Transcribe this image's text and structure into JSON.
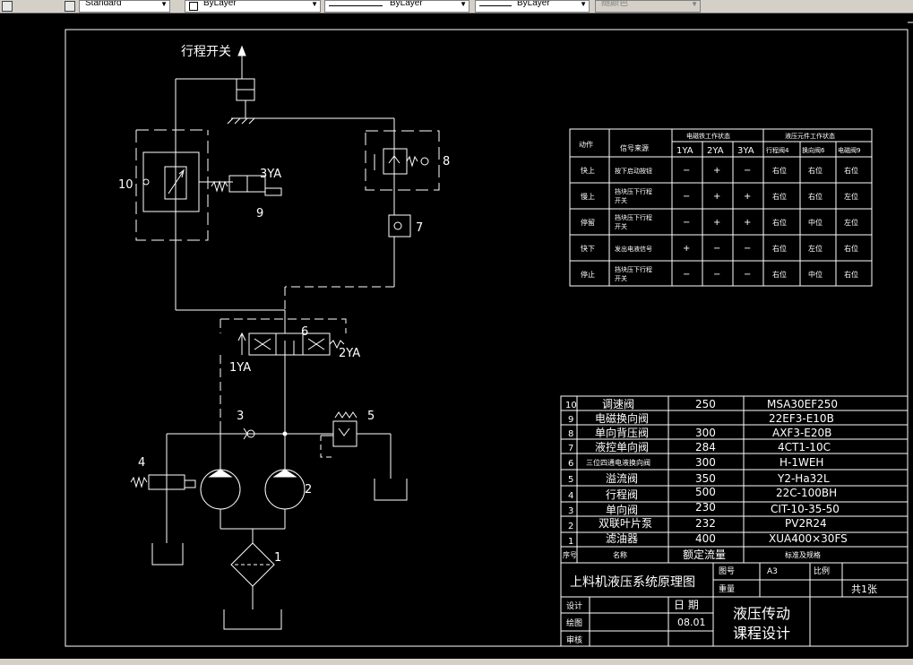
{
  "toolbar": {
    "text_style": "Standard",
    "layer": "ByLayer",
    "linetype": "ByLayer",
    "lineweight": "ByLayer",
    "plotstyle": "随颜色"
  },
  "diagram": {
    "labels": {
      "switch": "行程开关",
      "n10": "10",
      "n3ya": "3YA",
      "n9": "9",
      "n8": "8",
      "n7": "7",
      "n6": "6",
      "n1ya": "1YA",
      "n2ya": "2YA",
      "n3": "3",
      "n5": "5",
      "n4": "4",
      "n2": "2",
      "n1": "1"
    }
  },
  "status_table": {
    "h_action": "动作",
    "h_signal": "信号来源",
    "h_magnet": "电磁铁工作状态",
    "h_hydraulic": "液压元件工作状态",
    "h_1ya": "1YA",
    "h_2ya": "2YA",
    "h_3ya": "3YA",
    "h_v4": "行程阀4",
    "h_v6": "换向阀6",
    "h_v9": "电磁阀9",
    "rows": [
      {
        "action": "快上",
        "sig1": "按下启动按钮",
        "sig2": "",
        "c1": "−",
        "c2": "+",
        "c3": "−",
        "c4": "右位",
        "c5": "右位",
        "c6": "右位"
      },
      {
        "action": "慢上",
        "sig1": "挡块压下行程",
        "sig2": "开关",
        "c1": "−",
        "c2": "+",
        "c3": "+",
        "c4": "右位",
        "c5": "右位",
        "c6": "左位"
      },
      {
        "action": "停留",
        "sig1": "挡块压下行程",
        "sig2": "开关",
        "c1": "−",
        "c2": "+",
        "c3": "+",
        "c4": "右位",
        "c5": "中位",
        "c6": "左位"
      },
      {
        "action": "快下",
        "sig1": "发出电液信号",
        "sig2": "",
        "c1": "+",
        "c2": "−",
        "c3": "−",
        "c4": "右位",
        "c5": "左位",
        "c6": "右位"
      },
      {
        "action": "停止",
        "sig1": "挡块压下行程",
        "sig2": "开关",
        "c1": "−",
        "c2": "−",
        "c3": "−",
        "c4": "右位",
        "c5": "中位",
        "c6": "右位"
      }
    ]
  },
  "parts_list": [
    {
      "no": "10",
      "name": "调速阀",
      "flow": "250",
      "spec": "MSA30EF250"
    },
    {
      "no": "9",
      "name": "电磁换向阀",
      "flow": "",
      "spec": "22EF3-E10B"
    },
    {
      "no": "8",
      "name": "单向背压阀",
      "flow": "300",
      "spec": "AXF3-E20B"
    },
    {
      "no": "7",
      "name": "液控单向阀",
      "flow": "284",
      "spec": "4CT1-10C"
    },
    {
      "no": "6",
      "name": "三位四通电液换向阀",
      "flow": "300",
      "spec": "H-1WEH"
    },
    {
      "no": "5",
      "name": "溢流阀",
      "flow": "350",
      "spec": "Y2-Ha32L"
    },
    {
      "no": "4",
      "name": "行程阀",
      "flow": "500",
      "spec": "22C-100BH"
    },
    {
      "no": "3",
      "name": "单向阀",
      "flow": "230",
      "spec": "CIT-10-35-50"
    },
    {
      "no": "2",
      "name": "双联叶片泵",
      "flow": "232",
      "spec": "PV2R24"
    },
    {
      "no": "1",
      "name": "滤油器",
      "flow": "400",
      "spec": "XUA400×30FS"
    }
  ],
  "parts_header": {
    "no": "序号",
    "name": "名称",
    "flow": "额定流量",
    "spec": "标准及规格"
  },
  "title_block": {
    "drawing_title": "上料机液压系统原理图",
    "drawing_no_label": "图号",
    "drawing_no": "A3",
    "scale_label": "比例",
    "weight_label": "重量",
    "sheets": "共1张",
    "design": "设计",
    "date_label": "日 期",
    "draw": "绘图",
    "date": "08.01",
    "review": "审核",
    "course_line1": "液压传动",
    "course_line2": "课程设计"
  }
}
